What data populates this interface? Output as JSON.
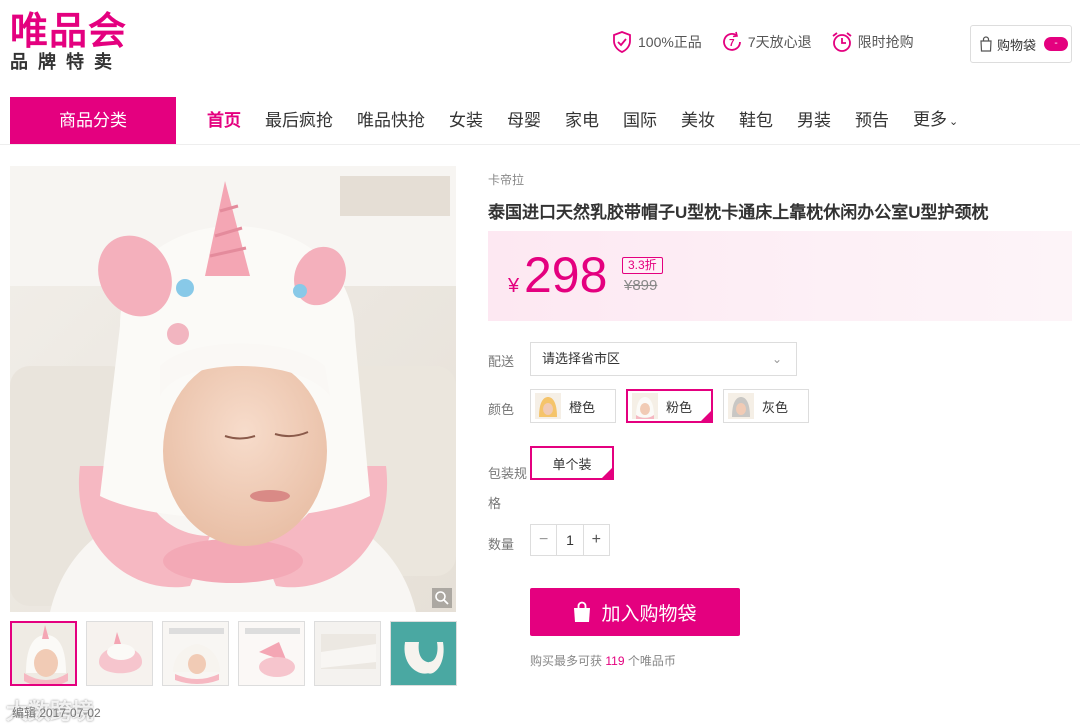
{
  "header": {
    "logo_main": "唯品会",
    "logo_sub": "品牌特卖",
    "promises": [
      {
        "icon": "shield-check-icon",
        "text": "100%正品"
      },
      {
        "icon": "seven-days-return-icon",
        "text": "7天放心退"
      },
      {
        "icon": "alarm-clock-icon",
        "text": "限时抢购"
      }
    ],
    "cart_label": "购物袋",
    "cart_badge": "-"
  },
  "nav": {
    "category_button": "商品分类",
    "items": [
      "首页",
      "最后疯抢",
      "唯品快抢",
      "女装",
      "母婴",
      "家电",
      "国际",
      "美妆",
      "鞋包",
      "男装",
      "预告",
      "更多"
    ],
    "active_index": 0
  },
  "product": {
    "brand": "卡帝拉",
    "title": "泰国进口天然乳胶带帽子U型枕卡通床上靠枕休闲办公室U型护颈枕",
    "price_currency": "¥",
    "price": "298",
    "discount": "3.3折",
    "original_price": "¥899",
    "delivery_label": "配送",
    "delivery_placeholder": "请选择省市区",
    "color_label": "颜色",
    "colors": [
      {
        "name": "橙色",
        "selected": false
      },
      {
        "name": "粉色",
        "selected": true
      },
      {
        "name": "灰色",
        "selected": false
      }
    ],
    "pack_label": "包装规格",
    "pack_label_line1": "包装规",
    "pack_label_line2": "格",
    "pack_option": "单个装",
    "qty_label": "数量",
    "qty_minus": "−",
    "qty_value": "1",
    "qty_plus": "+",
    "add_to_cart": "加入购物袋",
    "coins_prefix": "购买最多可获",
    "coins_count": "119",
    "coins_suffix": "个唯品币"
  },
  "watermark": {
    "text": "大数跨境",
    "sub": "编辑 2017-07-02"
  },
  "colors": {
    "brand_pink": "#e4007f"
  }
}
